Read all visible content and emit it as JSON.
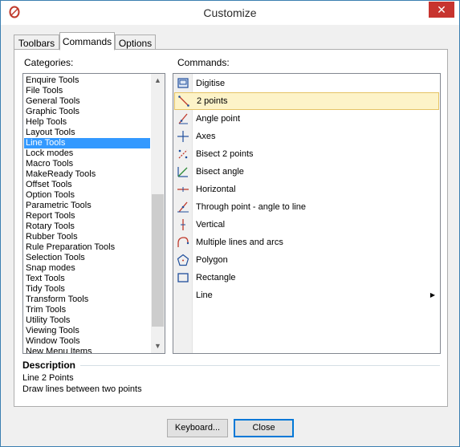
{
  "window": {
    "title": "Customize",
    "close_glyph": "✕"
  },
  "tabs": [
    {
      "label": "Toolbars",
      "active": false
    },
    {
      "label": "Commands",
      "active": true
    },
    {
      "label": "Options",
      "active": false
    }
  ],
  "categories": {
    "label": "Categories:",
    "selected": "Line Tools",
    "items": [
      "Enquire Tools",
      "File Tools",
      "General Tools",
      "Graphic Tools",
      "Help Tools",
      "Layout Tools",
      "Line Tools",
      "Lock modes",
      "Macro Tools",
      "MakeReady Tools",
      "Offset Tools",
      "Option Tools",
      "Parametric Tools",
      "Report Tools",
      "Rotary Tools",
      "Rubber Tools",
      "Rule Preparation Tools",
      "Selection Tools",
      "Snap modes",
      "Text Tools",
      "Tidy Tools",
      "Transform Tools",
      "Trim Tools",
      "Utility Tools",
      "Viewing Tools",
      "Window Tools",
      "New Menu Items"
    ]
  },
  "commands": {
    "label": "Commands:",
    "selected": "2 points",
    "items": [
      {
        "label": "Digitise",
        "icon": "digitise-icon"
      },
      {
        "label": "2 points",
        "icon": "line-2-points-icon"
      },
      {
        "label": "Angle point",
        "icon": "angle-point-icon"
      },
      {
        "label": "Axes",
        "icon": "axes-icon"
      },
      {
        "label": "Bisect 2 points",
        "icon": "bisect-2-points-icon"
      },
      {
        "label": "Bisect angle",
        "icon": "bisect-angle-icon"
      },
      {
        "label": "Horizontal",
        "icon": "horizontal-line-icon"
      },
      {
        "label": "Through point - angle to line",
        "icon": "through-point-angle-icon"
      },
      {
        "label": "Vertical",
        "icon": "vertical-line-icon"
      },
      {
        "label": "Multiple lines and arcs",
        "icon": "lines-and-arcs-icon"
      },
      {
        "label": "Polygon",
        "icon": "polygon-icon"
      },
      {
        "label": "Rectangle",
        "icon": "rectangle-icon"
      },
      {
        "label": "Line",
        "icon": "",
        "submenu": true
      }
    ]
  },
  "description": {
    "title": "Description",
    "name": "Line 2 Points",
    "text": "Draw lines between two points"
  },
  "buttons": {
    "keyboard": "Keyboard...",
    "close": "Close"
  },
  "colors": {
    "selection_blue": "#3399ff",
    "command_highlight": "#fdf3c8",
    "icon_red": "#c0392b",
    "icon_blue": "#1f4e9c"
  }
}
